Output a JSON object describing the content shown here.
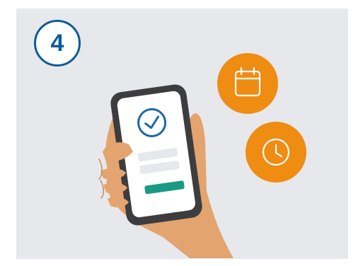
{
  "step": {
    "number": "4"
  },
  "colors": {
    "panel_background": "#e6e8ec",
    "badge_outline": "#0e5c99",
    "accent_orange": "#ef8c12",
    "confirm_green": "#1a9a83",
    "skin": "#e3a46f",
    "phone_frame": "#3d3d40",
    "check_blue": "#1c67a8"
  },
  "icons": {
    "check": "checkmark-circle-icon",
    "calendar": "calendar-icon",
    "clock": "clock-icon"
  }
}
